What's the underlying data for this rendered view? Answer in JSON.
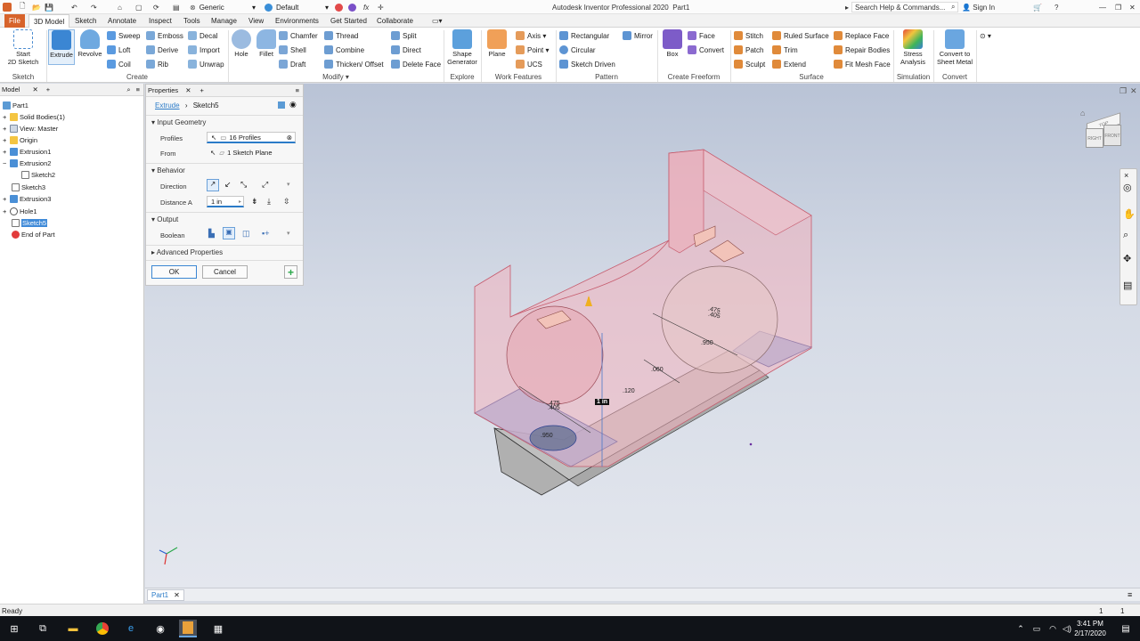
{
  "app": {
    "title": "Autodesk Inventor Professional 2020",
    "document": "Part1"
  },
  "qat": {
    "material": "Generic",
    "appearance": "Default",
    "search_placeholder": "Search Help & Commands...",
    "sign_in": "Sign In"
  },
  "tabs": [
    "File",
    "3D Model",
    "Sketch",
    "Annotate",
    "Inspect",
    "Tools",
    "Manage",
    "View",
    "Environments",
    "Get Started",
    "Collaborate"
  ],
  "ribbon": {
    "sketch": {
      "start": "Start",
      "start2": "2D Sketch",
      "title": "Sketch"
    },
    "create": {
      "extrude": "Extrude",
      "revolve": "Revolve",
      "sweep": "Sweep",
      "loft": "Loft",
      "coil": "Coil",
      "emboss": "Emboss",
      "derive": "Derive",
      "rib": "Rib",
      "decal": "Decal",
      "import": "Import",
      "unwrap": "Unwrap",
      "title": "Create"
    },
    "modify": {
      "hole": "Hole",
      "fillet": "Fillet",
      "chamfer": "Chamfer",
      "shell": "Shell",
      "draft": "Draft",
      "thread": "Thread",
      "combine": "Combine",
      "thicken": "Thicken/ Offset",
      "split": "Split",
      "direct": "Direct",
      "delete_face": "Delete Face",
      "title": "Modify"
    },
    "explore": {
      "shape1": "Shape",
      "shape2": "Generator",
      "title": "Explore"
    },
    "work": {
      "plane": "Plane",
      "axis": "Axis",
      "point": "Point",
      "ucs": "UCS",
      "title": "Work Features"
    },
    "pattern": {
      "rectangular": "Rectangular",
      "circular": "Circular",
      "sketch_driven": "Sketch Driven",
      "mirror": "Mirror",
      "title": "Pattern"
    },
    "freeform": {
      "box": "Box",
      "face": "Face",
      "convert": "Convert",
      "title": "Create Freeform"
    },
    "surface": {
      "stitch": "Stitch",
      "patch": "Patch",
      "sculpt": "Sculpt",
      "ruled": "Ruled Surface",
      "trim": "Trim",
      "extend": "Extend",
      "replace": "Replace Face",
      "repair": "Repair Bodies",
      "fit_mesh": "Fit Mesh Face",
      "title": "Surface"
    },
    "simulation": {
      "stress1": "Stress",
      "stress2": "Analysis",
      "title": "Simulation"
    },
    "convert": {
      "c1": "Convert to",
      "c2": "Sheet Metal",
      "title": "Convert"
    }
  },
  "browser": {
    "tab": "Model",
    "items": [
      {
        "label": "Part1",
        "level": 0
      },
      {
        "label": "Solid Bodies(1)",
        "level": 1
      },
      {
        "label": "View: Master",
        "level": 1
      },
      {
        "label": "Origin",
        "level": 1
      },
      {
        "label": "Extrusion1",
        "level": 1
      },
      {
        "label": "Extrusion2",
        "level": 1
      },
      {
        "label": "Sketch2",
        "level": 2
      },
      {
        "label": "Sketch3",
        "level": 1
      },
      {
        "label": "Extrusion3",
        "level": 1
      },
      {
        "label": "Hole1",
        "level": 1
      },
      {
        "label": "Sketch5",
        "level": 1
      },
      {
        "label": "End of Part",
        "level": 1
      }
    ]
  },
  "properties": {
    "tab": "Properties",
    "breadcrumb_cmd": "Extrude",
    "breadcrumb_sketch": "Sketch5",
    "input_geometry": "Input Geometry",
    "profiles_label": "Profiles",
    "profiles_value": "16 Profiles",
    "from_label": "From",
    "from_value": "1 Sketch Plane",
    "behavior": "Behavior",
    "direction_label": "Direction",
    "distance_label": "Distance A",
    "distance_value": "1 in",
    "output": "Output",
    "boolean_label": "Boolean",
    "advanced": "Advanced Properties",
    "ok": "OK",
    "cancel": "Cancel"
  },
  "viewport": {
    "dims": [
      ".475",
      ".405",
      ".950",
      ".060",
      ".120",
      ".475",
      ".405",
      ".950"
    ],
    "distance_tag": "1 in",
    "viewcube": {
      "top": "TOP",
      "front": "FRONT",
      "right": "RIGHT"
    }
  },
  "doc_tab": "Part1",
  "status": {
    "text": "Ready",
    "n1": "1",
    "n2": "1"
  },
  "taskbar": {
    "time": "3:41 PM",
    "date": "2/17/2020"
  },
  "colors": {
    "file_tab": "#d7632b",
    "accent": "#2b7bc8",
    "body_pink": "#f3b3bd"
  }
}
